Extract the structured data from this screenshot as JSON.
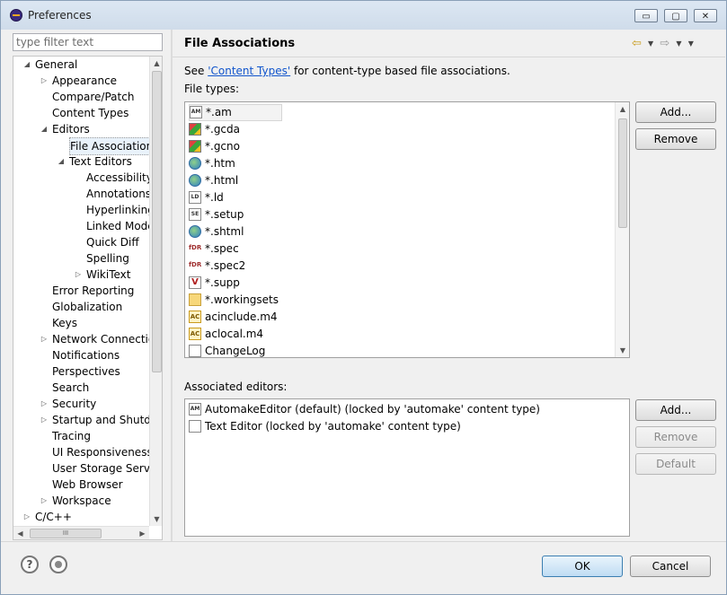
{
  "window": {
    "title": "Preferences",
    "controls": {
      "minimize": "▭",
      "maximize": "▢",
      "close": "✕"
    }
  },
  "filter": {
    "placeholder": "type filter text"
  },
  "tree": {
    "items": [
      {
        "label": "General",
        "depth": 0,
        "twisty": "expanded"
      },
      {
        "label": "Appearance",
        "depth": 1,
        "twisty": "collapsed"
      },
      {
        "label": "Compare/Patch",
        "depth": 1,
        "twisty": "none"
      },
      {
        "label": "Content Types",
        "depth": 1,
        "twisty": "none"
      },
      {
        "label": "Editors",
        "depth": 1,
        "twisty": "expanded"
      },
      {
        "label": "File Associations",
        "depth": 2,
        "twisty": "none",
        "selected": true
      },
      {
        "label": "Text Editors",
        "depth": 2,
        "twisty": "expanded"
      },
      {
        "label": "Accessibility",
        "depth": 3,
        "twisty": "none"
      },
      {
        "label": "Annotations",
        "depth": 3,
        "twisty": "none"
      },
      {
        "label": "Hyperlinking",
        "depth": 3,
        "twisty": "none"
      },
      {
        "label": "Linked Mode",
        "depth": 3,
        "twisty": "none"
      },
      {
        "label": "Quick Diff",
        "depth": 3,
        "twisty": "none"
      },
      {
        "label": "Spelling",
        "depth": 3,
        "twisty": "none"
      },
      {
        "label": "WikiText",
        "depth": 3,
        "twisty": "collapsed"
      },
      {
        "label": "Error Reporting",
        "depth": 1,
        "twisty": "none"
      },
      {
        "label": "Globalization",
        "depth": 1,
        "twisty": "none"
      },
      {
        "label": "Keys",
        "depth": 1,
        "twisty": "none"
      },
      {
        "label": "Network Connections",
        "depth": 1,
        "twisty": "collapsed"
      },
      {
        "label": "Notifications",
        "depth": 1,
        "twisty": "none"
      },
      {
        "label": "Perspectives",
        "depth": 1,
        "twisty": "none"
      },
      {
        "label": "Search",
        "depth": 1,
        "twisty": "none"
      },
      {
        "label": "Security",
        "depth": 1,
        "twisty": "collapsed"
      },
      {
        "label": "Startup and Shutdown",
        "depth": 1,
        "twisty": "collapsed"
      },
      {
        "label": "Tracing",
        "depth": 1,
        "twisty": "none"
      },
      {
        "label": "UI Responsiveness Monitoring",
        "depth": 1,
        "twisty": "none"
      },
      {
        "label": "User Storage Service",
        "depth": 1,
        "twisty": "none"
      },
      {
        "label": "Web Browser",
        "depth": 1,
        "twisty": "none"
      },
      {
        "label": "Workspace",
        "depth": 1,
        "twisty": "collapsed"
      },
      {
        "label": "C/C++",
        "depth": 0,
        "twisty": "collapsed"
      }
    ],
    "hscroll_grip": "III"
  },
  "page": {
    "title": "File Associations",
    "description_prefix": "See ",
    "description_link": "'Content Types'",
    "description_suffix": " for content-type based file associations.",
    "file_types_label": "File types:",
    "associated_editors_label": "Associated editors:"
  },
  "file_types": [
    {
      "name": "*.am",
      "icon": "am-icon",
      "glyph": "AM",
      "selected": true
    },
    {
      "name": "*.gcda",
      "icon": "gcov-icon",
      "glyph": ""
    },
    {
      "name": "*.gcno",
      "icon": "gcov-icon",
      "glyph": ""
    },
    {
      "name": "*.htm",
      "icon": "globe-icon",
      "glyph": ""
    },
    {
      "name": "*.html",
      "icon": "globe-icon",
      "glyph": ""
    },
    {
      "name": "*.ld",
      "icon": "ld-icon",
      "glyph": "LD"
    },
    {
      "name": "*.setup",
      "icon": "setup-icon",
      "glyph": "SE"
    },
    {
      "name": "*.shtml",
      "icon": "globe-icon",
      "glyph": ""
    },
    {
      "name": "*.spec",
      "icon": "rpm-spec-icon",
      "glyph": "fDR"
    },
    {
      "name": "*.spec2",
      "icon": "rpm-spec-icon",
      "glyph": "fDR"
    },
    {
      "name": "*.supp",
      "icon": "valgrind-icon",
      "glyph": "V"
    },
    {
      "name": "*.workingsets",
      "icon": "folder-icon",
      "glyph": ""
    },
    {
      "name": "acinclude.m4",
      "icon": "autoconf-icon",
      "glyph": "AC"
    },
    {
      "name": "aclocal.m4",
      "icon": "autoconf-icon",
      "glyph": "AC"
    },
    {
      "name": "ChangeLog",
      "icon": "document-icon",
      "glyph": ""
    }
  ],
  "associated_editors": [
    {
      "name": "AutomakeEditor (default) (locked by 'automake' content type)",
      "icon": "am-icon",
      "glyph": "AM"
    },
    {
      "name": "Text Editor (locked by 'automake' content type)",
      "icon": "document-icon",
      "glyph": ""
    }
  ],
  "buttons": {
    "file_add": "Add...",
    "file_remove": "Remove",
    "editor_add": "Add...",
    "editor_remove": "Remove",
    "editor_default": "Default",
    "ok": "OK",
    "cancel": "Cancel"
  },
  "nav": {
    "back": "⇦",
    "forward": "⇨",
    "dropdown": "▼",
    "menu": "▼"
  },
  "footer": {
    "help_glyph": "?"
  }
}
